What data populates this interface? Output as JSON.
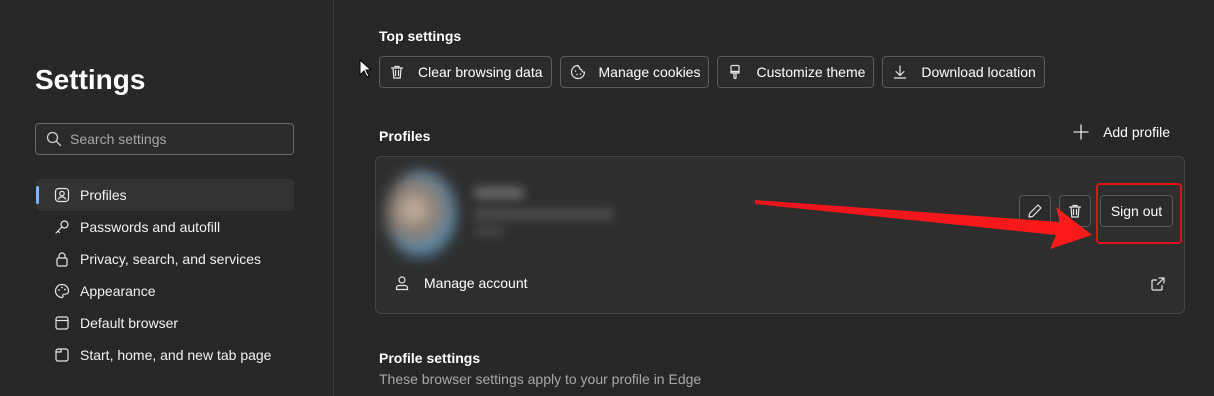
{
  "sidebar": {
    "title": "Settings",
    "search_placeholder": "Search settings",
    "items": [
      {
        "label": "Profiles",
        "icon": "profile-icon",
        "active": true
      },
      {
        "label": "Passwords and autofill",
        "icon": "key-icon"
      },
      {
        "label": "Privacy, search, and services",
        "icon": "lock-icon"
      },
      {
        "label": "Appearance",
        "icon": "palette-icon"
      },
      {
        "label": "Default browser",
        "icon": "browser-icon"
      },
      {
        "label": "Start, home, and new tab page",
        "icon": "tab-page-icon"
      }
    ]
  },
  "top_settings": {
    "heading": "Top settings",
    "buttons": [
      {
        "label": "Clear browsing data",
        "icon": "trash-icon"
      },
      {
        "label": "Manage cookies",
        "icon": "cookie-icon"
      },
      {
        "label": "Customize theme",
        "icon": "brush-icon"
      },
      {
        "label": "Download location",
        "icon": "download-icon"
      }
    ]
  },
  "profiles": {
    "heading": "Profiles",
    "add_profile_label": "Add profile",
    "card": {
      "sign_out_label": "Sign out",
      "manage_account_label": "Manage account"
    }
  },
  "profile_settings": {
    "heading": "Profile settings",
    "subtitle": "These browser settings apply to your profile in Edge"
  },
  "colors": {
    "background": "#272727",
    "accent": "#7db4ff",
    "annotation_red": "#e0121a"
  }
}
